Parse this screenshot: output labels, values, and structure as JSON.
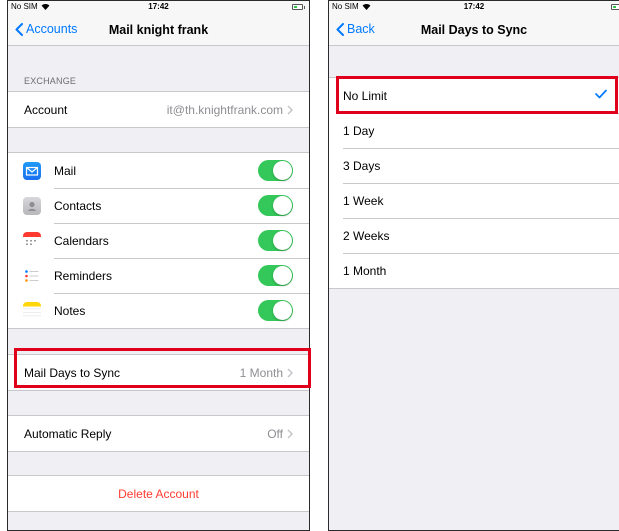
{
  "left": {
    "status": {
      "carrier": "No SIM",
      "time": "17:42"
    },
    "nav": {
      "back": "Accounts",
      "title": "Mail knight frank"
    },
    "section_header": "EXCHANGE",
    "account": {
      "label": "Account",
      "value": "it@th.knightfrank.com"
    },
    "services": [
      {
        "label": "Mail",
        "icon": "mail-icon",
        "on": true
      },
      {
        "label": "Contacts",
        "icon": "contacts-icon",
        "on": true
      },
      {
        "label": "Calendars",
        "icon": "calendar-icon",
        "on": true
      },
      {
        "label": "Reminders",
        "icon": "reminders-icon",
        "on": true
      },
      {
        "label": "Notes",
        "icon": "notes-icon",
        "on": true
      }
    ],
    "sync": {
      "label": "Mail Days to Sync",
      "value": "1 Month"
    },
    "auto_reply": {
      "label": "Automatic Reply",
      "value": "Off"
    },
    "delete_label": "Delete Account"
  },
  "right": {
    "status": {
      "carrier": "No SIM",
      "time": "17:42"
    },
    "nav": {
      "back": "Back",
      "title": "Mail Days to Sync"
    },
    "options": [
      "No Limit",
      "1 Day",
      "3 Days",
      "1 Week",
      "2 Weeks",
      "1 Month"
    ],
    "selected_index": 0
  },
  "colors": {
    "accent": "#007aff",
    "toggle_on": "#34c759",
    "destructive": "#ff3b30",
    "highlight": "#e0001b",
    "grouped_background": "#efeff4"
  }
}
